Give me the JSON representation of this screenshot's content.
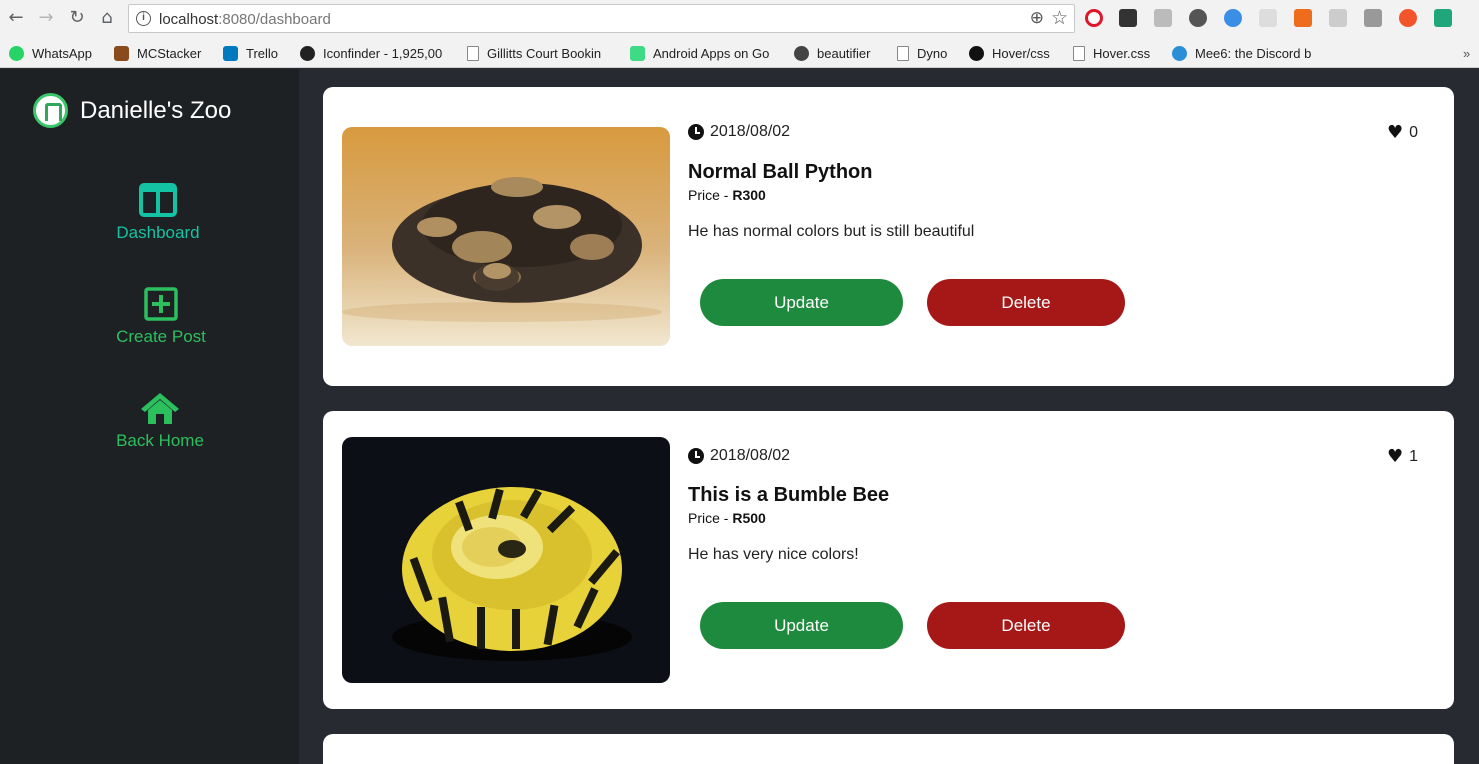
{
  "browser": {
    "url_host": "localhost",
    "url_rest": ":8080/dashboard",
    "bookmarks": [
      {
        "label": "WhatsApp",
        "icon": "whatsapp-icon",
        "color": "#25d366"
      },
      {
        "label": "MCStacker",
        "icon": "mcstacker-icon",
        "color": "#8a4b1c"
      },
      {
        "label": "Trello",
        "icon": "trello-icon",
        "color": "#0079bf"
      },
      {
        "label": "Iconfinder - 1,925,00",
        "icon": "iconfinder-icon",
        "color": "#222222"
      },
      {
        "label": "Gillitts Court Bookin",
        "icon": "page-icon",
        "color": "#ffffff"
      },
      {
        "label": "Android Apps on Go",
        "icon": "google-play-icon",
        "color": "#3ddc84"
      },
      {
        "label": "beautifier",
        "icon": "beautifier-icon",
        "color": "#444444"
      },
      {
        "label": "Dyno",
        "icon": "page-icon",
        "color": "#ffffff"
      },
      {
        "label": "Hover/css",
        "icon": "github-icon",
        "color": "#111111"
      },
      {
        "label": "Hover.css",
        "icon": "page-icon",
        "color": "#ffffff"
      },
      {
        "label": "Mee6: the Discord b",
        "icon": "mee6-icon",
        "color": "#2a8fd6"
      }
    ]
  },
  "sidebar": {
    "brand": "Danielle's Zoo",
    "items": [
      {
        "label": "Dashboard",
        "icon": "dashboard-icon",
        "color": "#14c3a3"
      },
      {
        "label": "Create Post",
        "icon": "plus-square-icon",
        "color": "#2cbf5e"
      },
      {
        "label": "Back Home",
        "icon": "home-icon",
        "color": "#2cbf5e"
      }
    ]
  },
  "posts": [
    {
      "date": "2018/08/02",
      "likes": "0",
      "title": "Normal Ball Python",
      "price_prefix": "Price - ",
      "price": "R300",
      "description": "He has normal colors but is still beautiful",
      "update_label": "Update",
      "delete_label": "Delete"
    },
    {
      "date": "2018/08/02",
      "likes": "1",
      "title": "This is a Bumble Bee",
      "price_prefix": "Price - ",
      "price": "R500",
      "description": "He has very nice colors!",
      "update_label": "Update",
      "delete_label": "Delete"
    }
  ],
  "colors": {
    "sidebar_bg": "#1e2124",
    "main_bg": "#272a30",
    "update": "#1e8a3e",
    "delete": "#a61717",
    "accent_teal": "#14c3a3",
    "accent_green": "#2cbf5e"
  }
}
